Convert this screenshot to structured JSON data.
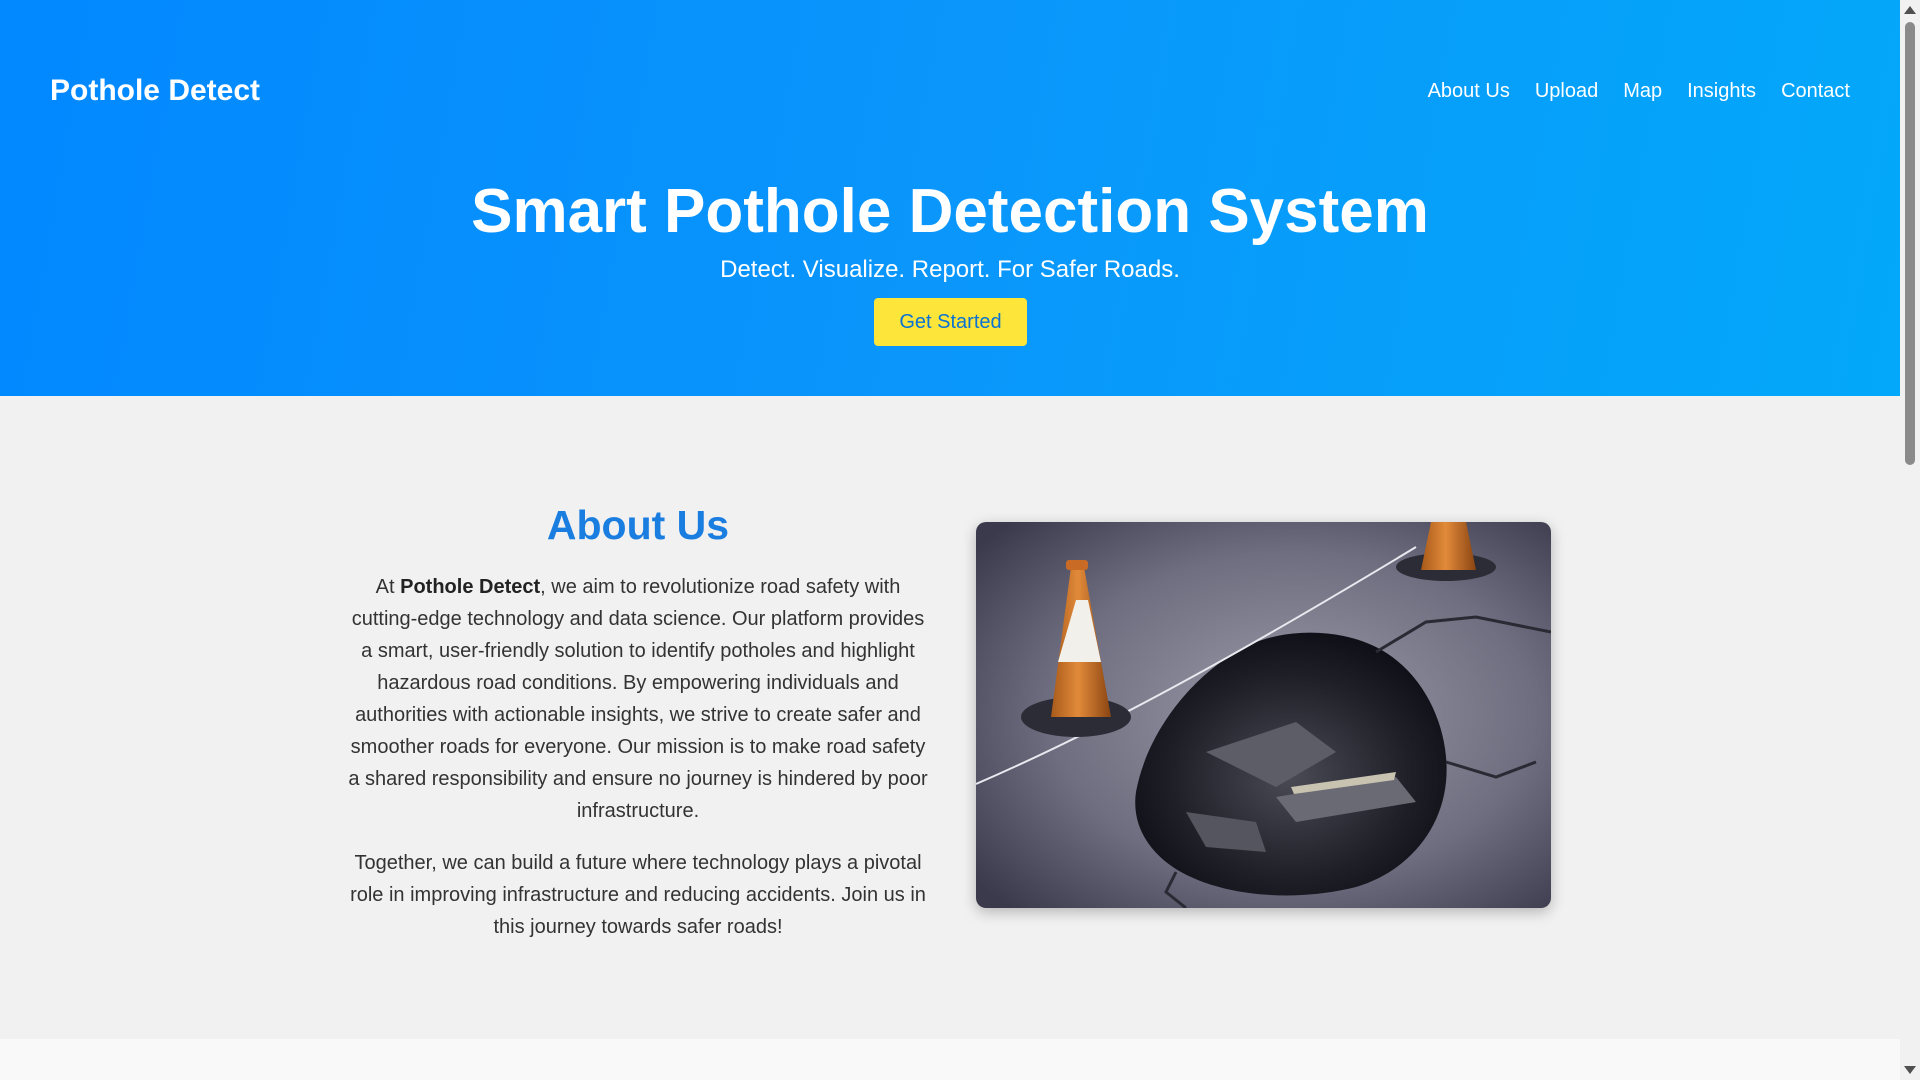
{
  "header": {
    "brand": "Pothole Detect",
    "nav": [
      "About Us",
      "Upload",
      "Map",
      "Insights",
      "Contact"
    ]
  },
  "hero": {
    "title": "Smart Pothole Detection System",
    "subtitle": "Detect. Visualize. Report. For Safer Roads.",
    "cta_label": "Get Started"
  },
  "about": {
    "title": "About Us",
    "p1_prefix": "At ",
    "p1_brand": "Pothole Detect",
    "p1_rest": ", we aim to revolutionize road safety with cutting-edge technology and data science. Our platform provides a smart, user-friendly solution to identify potholes and highlight hazardous road conditions. By empowering individuals and authorities with actionable insights, we strive to create safer and smoother roads for everyone. Our mission is to make road safety a shared responsibility and ensure no journey is hindered by poor infrastructure.",
    "p2": "Together, we can build a future where technology plays a pivotal role in improving infrastructure and reducing accidents. Join us in this journey towards safer roads!",
    "image_icon": "pothole-photo"
  },
  "colors": {
    "hero_gradient_start": "#0288ff",
    "hero_gradient_end": "#03a8fa",
    "cta_bg": "#fde53a",
    "cta_text": "#0a72d4",
    "about_title": "#1a7de0",
    "about_bg": "#f1f1f1"
  }
}
